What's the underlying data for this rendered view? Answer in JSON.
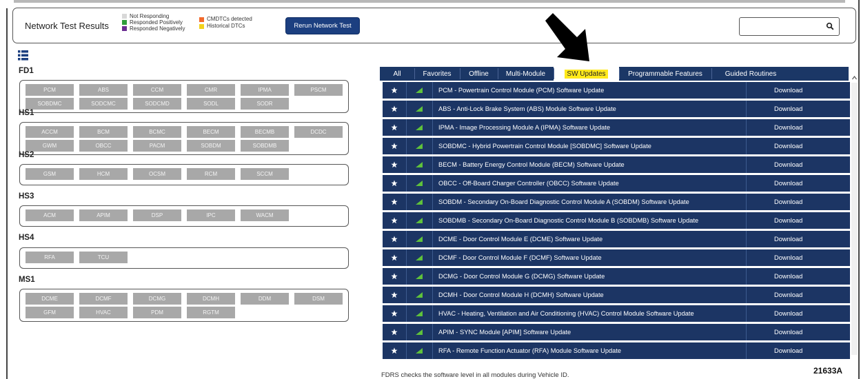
{
  "header": {
    "title": "Network Test Results",
    "legend_col1": [
      {
        "label": "Not Responding",
        "color": "#d8d8d8"
      },
      {
        "label": "Responded Positively",
        "color": "#2f9e3a"
      },
      {
        "label": "Responded Negatively",
        "color": "#6a2c91"
      }
    ],
    "legend_col2": [
      {
        "label": "CMDTCs detected",
        "color": "#f26a2c"
      },
      {
        "label": "Historical DTCs",
        "color": "#f2d21c"
      }
    ],
    "rerun_label": "Rerun Network Test",
    "search_value": ""
  },
  "groups": [
    {
      "name": "FD1",
      "rows": [
        [
          "PCM",
          "ABS",
          "CCM",
          "CMR",
          "IPMA",
          "PSCM"
        ],
        [
          "SOBDMC",
          "SODCMC",
          "SODCMD",
          "SODL",
          "SODR"
        ]
      ]
    },
    {
      "name": "HS1",
      "rows": [
        [
          "ACCM",
          "BCM",
          "BCMC",
          "BECM",
          "BECMB",
          "DCDC"
        ],
        [
          "GWM",
          "OBCC",
          "PACM",
          "SOBDM",
          "SOBDMB"
        ]
      ]
    },
    {
      "name": "HS2",
      "rows": [
        [
          "GSM",
          "HCM",
          "OCSM",
          "RCM",
          "SCCM"
        ]
      ]
    },
    {
      "name": "HS3",
      "rows": [
        [
          "ACM",
          "APIM",
          "DSP",
          "IPC",
          "WACM"
        ]
      ]
    },
    {
      "name": "HS4",
      "rows": [
        [
          "RFA",
          "TCU"
        ]
      ]
    },
    {
      "name": "MS1",
      "rows": [
        [
          "DCME",
          "DCMF",
          "DCMG",
          "DCMH",
          "DDM",
          "DSM"
        ],
        [
          "GFM",
          "HVAC",
          "PDM",
          "RGTM"
        ]
      ]
    }
  ],
  "tabs": [
    "All",
    "Favorites",
    "Offline",
    "Multi-Module",
    "SW Updates",
    "Programmable Features",
    "Guided Routines"
  ],
  "selected_tab": "SW Updates",
  "updates": [
    "PCM - Powertrain Control Module (PCM) Software Update",
    "ABS - Anti-Lock Brake System (ABS) Module Software Update",
    "IPMA - Image Processing Module A (IPMA) Software Update",
    "SOBDMC - Hybrid Powertrain Control Module [SOBDMC] Software Update",
    "BECM - Battery Energy Control Module (BECM) Software Update",
    "OBCC - Off-Board Charger Controller (OBCC) Software Update",
    "SOBDM - Secondary On-Board Diagnostic Control Module A (SOBDM) Software Update",
    "SOBDMB - Secondary On-Board Diagnostic Control Module B (SOBDMB) Software Update",
    "DCME - Door Control Module E (DCME) Software Update",
    "DCMF - Door Control Module F (DCMF) Software Update",
    "DCMG - Door Control Module G (DCMG) Software Update",
    "DCMH - Door Control Module H (DCMH) Software Update",
    "HVAC - Heating, Ventilation and Air Conditioning (HVAC) Control Module Software Update",
    "APIM - SYNC Module [APIM] Software Update",
    "RFA - Remote Function Actuator (RFA) Module Software Update"
  ],
  "download_label": "Download",
  "footer_text": "FDRS checks the software level in all modules during Vehicle ID.",
  "figure_id": "21633A",
  "colors": {
    "accent": "#1c3564",
    "selected_tab_highlight": "#ffe91a",
    "module_button": "#a8a8a8",
    "signal": "#5fc23b"
  }
}
